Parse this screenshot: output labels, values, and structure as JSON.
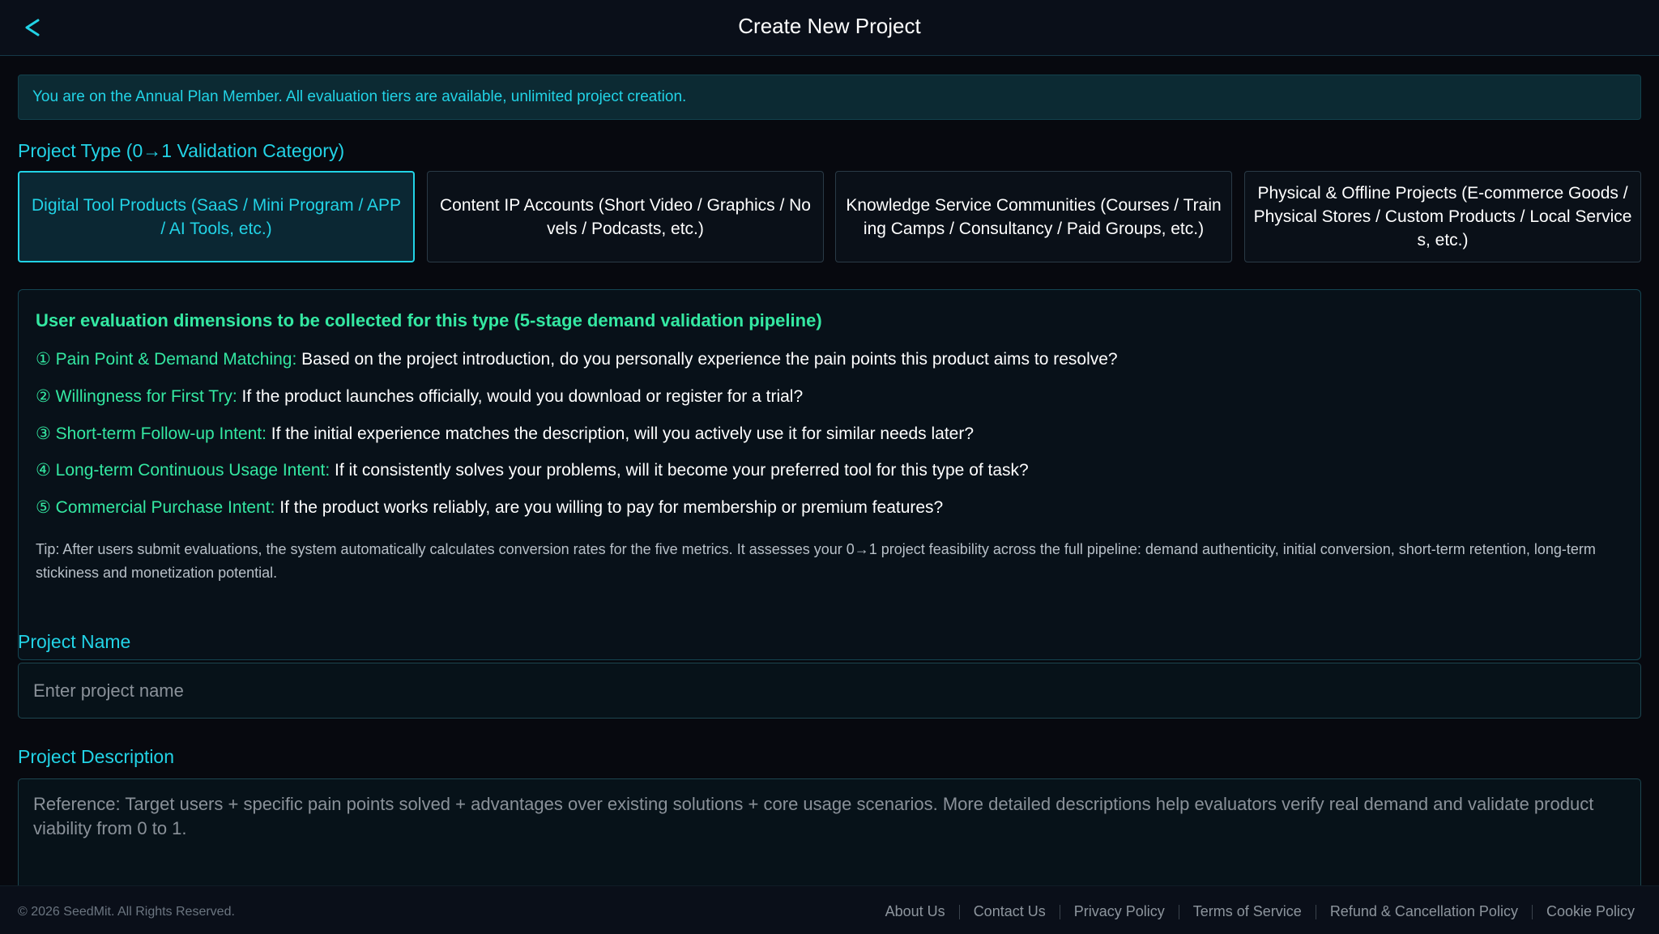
{
  "header": {
    "back_icon": "chevron-left-icon",
    "title": "Create New Project"
  },
  "notice": "You are on the Annual Plan Member. All evaluation tiers are available, unlimited project creation.",
  "project_type": {
    "label": "Project Type (0→1 Validation Category)",
    "options": [
      {
        "label": "Digital Tool Products (SaaS / Mini Program / APP / AI Tools, etc.)",
        "selected": true
      },
      {
        "label": "Content IP Accounts (Short Video / Graphics / Novels / Podcasts, etc.)",
        "selected": false
      },
      {
        "label": "Knowledge Service Communities (Courses / Training Camps / Consultancy / Paid Groups, etc.)",
        "selected": false
      },
      {
        "label": "Physical & Offline Projects (E-commerce Goods / Physical Stores / Custom Products / Local Services, etc.)",
        "selected": false
      }
    ]
  },
  "dimensions": {
    "title": "User evaluation dimensions to be collected for this type (5-stage demand validation pipeline)",
    "items": [
      {
        "label": "① Pain Point & Demand Matching:",
        "text": "Based on the project introduction, do you personally experience the pain points this product aims to resolve?"
      },
      {
        "label": "② Willingness for First Try:",
        "text": "If the product launches officially, would you download or register for a trial?"
      },
      {
        "label": "③ Short-term Follow-up Intent:",
        "text": "If the initial experience matches the description, will you actively use it for similar needs later?"
      },
      {
        "label": "④ Long-term Continuous Usage Intent:",
        "text": "If it consistently solves your problems, will it become your preferred tool for this type of task?"
      },
      {
        "label": "⑤ Commercial Purchase Intent:",
        "text": "If the product works reliably, are you willing to pay for membership or premium features?"
      }
    ],
    "tip": "Tip: After users submit evaluations, the system automatically calculates conversion rates for the five metrics. It assesses your 0→1 project feasibility across the full pipeline: demand authenticity, initial conversion, short-term retention, long-term stickiness and monetization potential."
  },
  "project_name": {
    "label": "Project Name",
    "placeholder": "Enter project name",
    "value": ""
  },
  "project_description": {
    "label": "Project Description",
    "placeholder": "Reference: Target users + specific pain points solved + advantages over existing solutions + core usage scenarios. More detailed descriptions help evaluators verify real demand and validate product viability from 0 to 1.",
    "value": ""
  },
  "footer": {
    "copyright": "© 2026 SeedMit. All Rights Reserved.",
    "links": [
      "About Us",
      "Contact Us",
      "Privacy Policy",
      "Terms of Service",
      "Refund & Cancellation Policy",
      "Cookie Policy"
    ]
  },
  "colors": {
    "background": "#07090f",
    "accent": "#22d3e6",
    "highlight_green": "#34e8a2"
  }
}
